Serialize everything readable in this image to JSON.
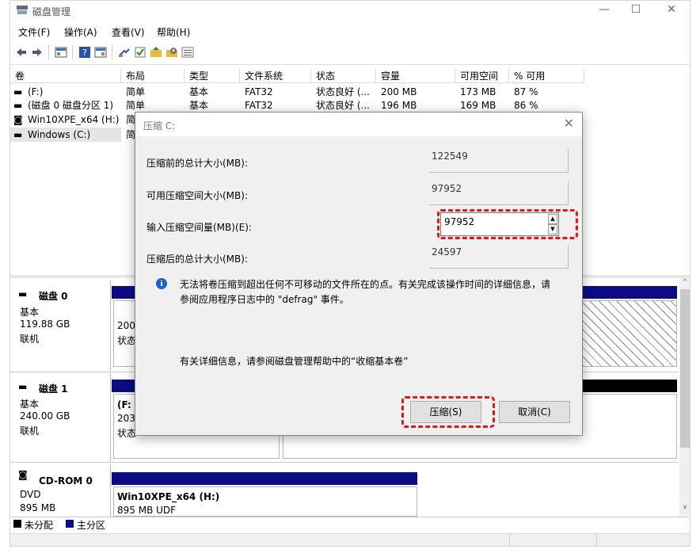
{
  "window": {
    "title": "磁盘管理"
  },
  "menu": [
    "文件(F)",
    "操作(A)",
    "查看(V)",
    "帮助(H)"
  ],
  "columns": [
    "卷",
    "布局",
    "类型",
    "文件系统",
    "状态",
    "容量",
    "可用空间",
    "% 可用"
  ],
  "volumes": [
    {
      "name": "(F:)",
      "layout": "简单",
      "type": "基本",
      "fs": "FAT32",
      "status": "状态良好 (...",
      "capacity": "200 MB",
      "free": "173 MB",
      "pct": "87 %"
    },
    {
      "name": "(磁盘 0 磁盘分区 1)",
      "layout": "简单",
      "type": "基本",
      "fs": "FAT32",
      "status": "状态良好 (...",
      "capacity": "196 MB",
      "free": "169 MB",
      "pct": "86 %"
    },
    {
      "name": "Win10XPE_x64 (H:)",
      "layout": "简"
    },
    {
      "name": "Windows (C:)",
      "layout": "简"
    }
  ],
  "dialog": {
    "title": "压缩 C:",
    "total_before_label": "压缩前的总计大小(MB):",
    "total_before_value": "122549",
    "available_label": "可用压缩空间大小(MB):",
    "available_value": "97952",
    "input_label": "输入压缩空间量(MB)(E):",
    "input_value": "97952",
    "total_after_label": "压缩后的总计大小(MB):",
    "total_after_value": "24597",
    "info_text_line1": "无法将卷压缩到超出任何不可移动的文件所在的点。有关完成该操作时间的详细信息，请",
    "info_text_line2": "参阅应用程序日志中的 \"defrag\" 事件。",
    "help_text": "有关详细信息，请参阅磁盘管理帮助中的“收缩基本卷”",
    "shrink_button": "压缩(S)",
    "cancel_button": "取消(C)"
  },
  "disks": [
    {
      "name": "磁盘 0",
      "type": "基本",
      "size": "119.88 GB",
      "state": "联机",
      "part_text1": "200",
      "part_text2": "状态"
    },
    {
      "name": "磁盘 1",
      "type": "基本",
      "size": "240.00 GB",
      "state": "联机",
      "part_text1": "(F:",
      "part_text2": "203",
      "part_text3": "状态"
    },
    {
      "name": "CD-ROM 0",
      "type": "DVD",
      "size": "895 MB",
      "part_title": "Win10XPE_x64  (H:)",
      "part_sub": "895 MB UDF"
    }
  ],
  "legend": {
    "unallocated": "未分配",
    "primary": "主分区"
  },
  "colors": {
    "primary": "#0c0c82",
    "unallocated": "#000000",
    "highlight": "#e41818",
    "info": "#1a63c8"
  }
}
